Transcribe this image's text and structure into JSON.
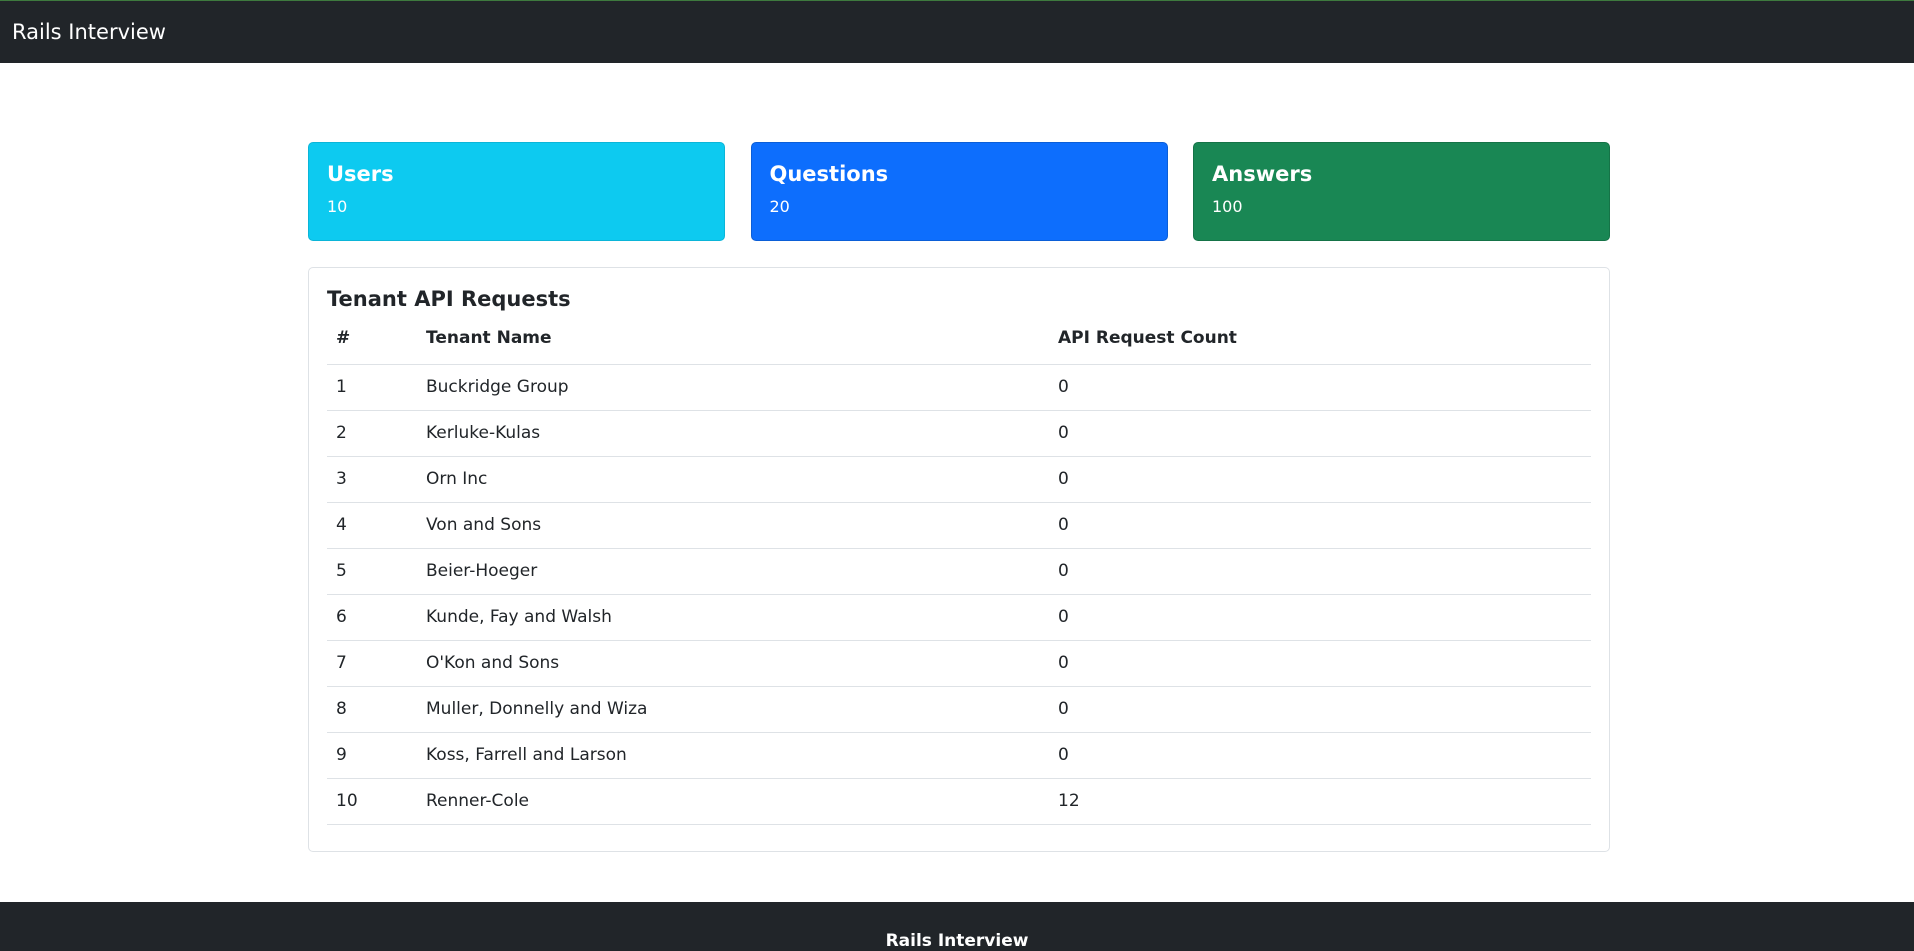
{
  "navbar": {
    "brand": "Rails Interview"
  },
  "stats": [
    {
      "title": "Users",
      "value": "10"
    },
    {
      "title": "Questions",
      "value": "20"
    },
    {
      "title": "Answers",
      "value": "100"
    }
  ],
  "table": {
    "title": "Tenant API Requests",
    "headers": [
      "#",
      "Tenant Name",
      "API Request Count"
    ],
    "rows": [
      {
        "id": "1",
        "name": "Buckridge Group",
        "count": "0"
      },
      {
        "id": "2",
        "name": "Kerluke-Kulas",
        "count": "0"
      },
      {
        "id": "3",
        "name": "Orn Inc",
        "count": "0"
      },
      {
        "id": "4",
        "name": "Von and Sons",
        "count": "0"
      },
      {
        "id": "5",
        "name": "Beier-Hoeger",
        "count": "0"
      },
      {
        "id": "6",
        "name": "Kunde, Fay and Walsh",
        "count": "0"
      },
      {
        "id": "7",
        "name": "O'Kon and Sons",
        "count": "0"
      },
      {
        "id": "8",
        "name": "Muller, Donnelly and Wiza",
        "count": "0"
      },
      {
        "id": "9",
        "name": "Koss, Farrell and Larson",
        "count": "0"
      },
      {
        "id": "10",
        "name": "Renner-Cole",
        "count": "12"
      }
    ]
  },
  "footer": {
    "text": "Rails Interview"
  },
  "colors": {
    "navbar_bg": "#212529",
    "users_card": "#0dcaf0",
    "questions_card": "#0d6efd",
    "answers_card": "#198754"
  }
}
